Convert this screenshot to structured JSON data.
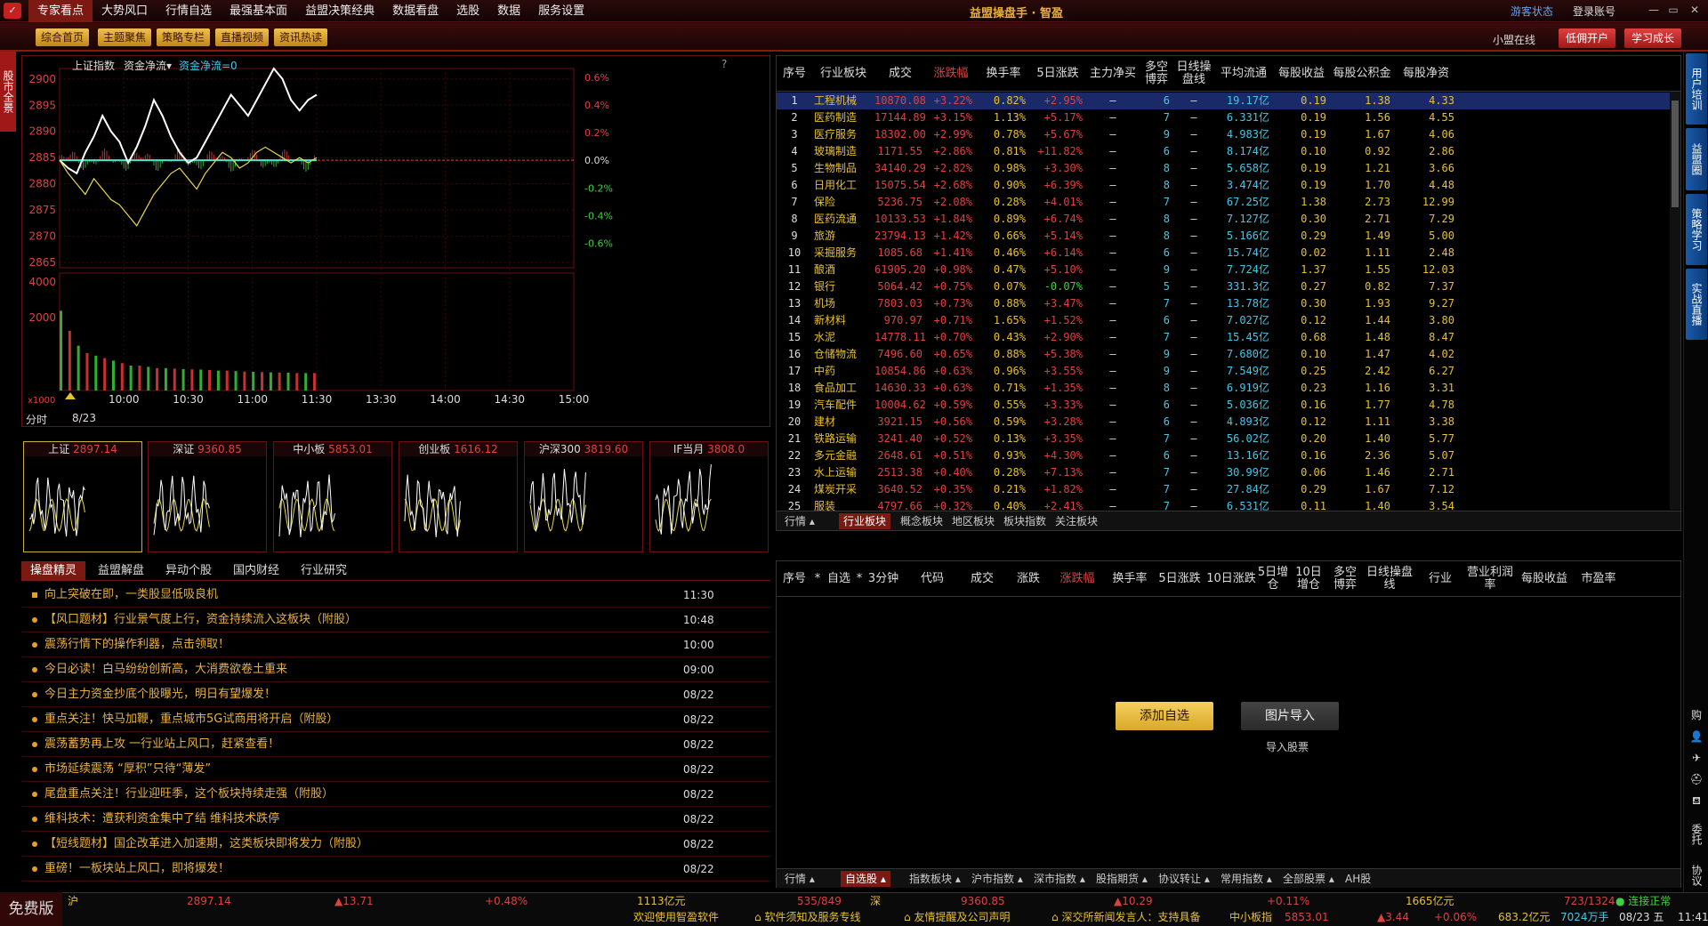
{
  "menubar": {
    "items": [
      "专家看点",
      "大势风口",
      "行情自选",
      "最强基本面",
      "益盟决策经典",
      "数据看盘",
      "选股",
      "数据",
      "服务设置"
    ],
    "active": 0,
    "app_title": "益盟操盘手 · 智盈",
    "guest": "游客状态",
    "account": "登录账号",
    "win_min": "—",
    "win_max": "▭",
    "win_close": "✕"
  },
  "toolbar": {
    "buttons": [
      "综合首页",
      "主题聚焦",
      "策略专栏",
      "直播视频",
      "资讯热读"
    ],
    "online": "小盟在线",
    "open_account": "低佣开户",
    "learn": "学习成长"
  },
  "leftstrip": {
    "tag": "股市全景"
  },
  "rightstrip": {
    "tabs": [
      "用户培训",
      "益盟圈",
      "策略学习",
      "实战直播"
    ],
    "icons": [
      "购",
      "👤",
      "✈",
      "⛑",
      "⛾",
      "委托",
      "协议"
    ]
  },
  "chart": {
    "index_name": "上证指数",
    "indicator": "资金净流▾",
    "indicator_value": "资金净流=0",
    "help": "?",
    "period": "分时",
    "date": "8/23",
    "unit": "x1000"
  },
  "chart_data": {
    "type": "line",
    "y_ticks": [
      2900,
      2895,
      2890,
      2885,
      2880,
      2875,
      2870,
      2865
    ],
    "pct_ticks": [
      "0.6%",
      "0.4%",
      "0.2%",
      "0.0%",
      "-0.2%",
      "-0.4%",
      "-0.6%"
    ],
    "vol_ticks": [
      4000,
      2000
    ],
    "x_ticks": [
      "10:00",
      "10:30",
      "11:00",
      "11:30",
      "13:30",
      "14:00",
      "14:30",
      "15:00"
    ],
    "ylim": [
      2864,
      2902
    ],
    "prev_close": 2884.5,
    "series": [
      {
        "values": [
          2884.5,
          2883,
          2882,
          2886,
          2889,
          2893,
          2890,
          2888,
          2884,
          2887,
          2891,
          2896,
          2893,
          2889,
          2886,
          2884,
          2885,
          2888,
          2891,
          2894,
          2897,
          2895,
          2893,
          2896,
          2899,
          2902,
          2900,
          2896,
          2894,
          2896,
          2897
        ]
      },
      {
        "values": [
          2884.5,
          2882,
          2880,
          2878,
          2881,
          2879,
          2877,
          2876,
          2874,
          2872,
          2875,
          2878,
          2880,
          2882,
          2883,
          2881,
          2879,
          2882,
          2884,
          2886,
          2885,
          2883,
          2884,
          2886,
          2887,
          2886,
          2885,
          2884,
          2885,
          2884,
          2885
        ]
      }
    ],
    "volume": [
      3200,
      2400,
      1800,
      1500,
      1400,
      1300,
      1200,
      1100,
      1000,
      1000,
      950,
      900,
      900,
      880,
      860,
      850,
      840,
      820,
      800,
      800,
      780,
      760,
      750,
      740,
      730,
      720,
      720,
      700,
      700,
      700
    ]
  },
  "minis": [
    {
      "name": "上证",
      "value": "2897.14"
    },
    {
      "name": "深证",
      "value": "9360.85"
    },
    {
      "name": "中小板",
      "value": "5853.01"
    },
    {
      "name": "创业板",
      "value": "1616.12"
    },
    {
      "name": "沪深300",
      "value": "3819.60"
    },
    {
      "name": "IF当月",
      "value": "3808.0"
    }
  ],
  "news": {
    "tabs": [
      "操盘精灵",
      "益盟解盘",
      "异动个股",
      "国内财经",
      "行业研究"
    ],
    "items": [
      {
        "title": "向上突破在即，一类股显低吸良机",
        "time": "11:30"
      },
      {
        "title": "【风口题材】行业景气度上行，资金持续流入这板块（附股）",
        "time": "10:48"
      },
      {
        "title": "震荡行情下的操作利器，点击领取！",
        "time": "10:00"
      },
      {
        "title": "今日必读！白马纷纷创新高，大消费欲卷土重来",
        "time": "09:00"
      },
      {
        "title": "今日主力资金抄底个股曝光，明日有望爆发！",
        "time": "08/22"
      },
      {
        "title": "重点关注！快马加鞭，重点城市5G试商用将开启（附股）",
        "time": "08/22"
      },
      {
        "title": "震荡蓄势再上攻 一行业站上风口，赶紧查看！",
        "time": "08/22"
      },
      {
        "title": "市场延续震荡 “厚积”只待“薄发”",
        "time": "08/22"
      },
      {
        "title": "尾盘重点关注！行业迎旺季，这个板块持续走强（附股）",
        "time": "08/22"
      },
      {
        "title": "维科技术：遭获利资金集中了结 维科技术跌停",
        "time": "08/22"
      },
      {
        "title": "【短线题材】国企改革进入加速期，这类板块即将发力（附股）",
        "time": "08/22"
      },
      {
        "title": "重磅！一板块站上风口，即将爆发！",
        "time": "08/22"
      }
    ]
  },
  "sectors": {
    "headers": [
      "序号",
      "行业板块",
      "成交",
      "涨跌幅",
      "换手率",
      "5日涨跌",
      "主力净买",
      "多空博弈",
      "日线操盘线",
      "平均流通",
      "每股收益",
      "每股公积金",
      "每股净资"
    ],
    "rows": [
      [
        "1",
        "工程机械",
        "10870.08",
        "+3.22%",
        "0.82%",
        "+2.95%",
        "—",
        "6",
        "—",
        "19.17亿",
        "0.19",
        "1.38",
        "4.33"
      ],
      [
        "2",
        "医药制造",
        "17144.89",
        "+3.15%",
        "1.13%",
        "+5.17%",
        "—",
        "7",
        "—",
        "6.331亿",
        "0.19",
        "1.56",
        "4.55"
      ],
      [
        "3",
        "医疗服务",
        "18302.00",
        "+2.99%",
        "0.78%",
        "+5.67%",
        "—",
        "9",
        "—",
        "4.983亿",
        "0.19",
        "1.67",
        "4.06"
      ],
      [
        "4",
        "玻璃制造",
        "1171.55",
        "+2.86%",
        "0.81%",
        "+11.82%",
        "—",
        "6",
        "—",
        "8.174亿",
        "0.10",
        "0.92",
        "2.86"
      ],
      [
        "5",
        "生物制品",
        "34140.29",
        "+2.82%",
        "0.98%",
        "+3.30%",
        "—",
        "8",
        "—",
        "5.658亿",
        "0.19",
        "1.21",
        "3.66"
      ],
      [
        "6",
        "日用化工",
        "15075.54",
        "+2.68%",
        "0.90%",
        "+6.39%",
        "—",
        "8",
        "—",
        "3.474亿",
        "0.19",
        "1.70",
        "4.48"
      ],
      [
        "7",
        "保险",
        "5236.75",
        "+2.08%",
        "0.28%",
        "+4.01%",
        "—",
        "7",
        "—",
        "67.25亿",
        "1.38",
        "2.73",
        "12.99"
      ],
      [
        "8",
        "医药流通",
        "10133.53",
        "+1.84%",
        "0.89%",
        "+6.74%",
        "—",
        "8",
        "—",
        "7.127亿",
        "0.30",
        "2.71",
        "7.29"
      ],
      [
        "9",
        "旅游",
        "23794.13",
        "+1.42%",
        "0.66%",
        "+5.14%",
        "—",
        "8",
        "—",
        "5.166亿",
        "0.29",
        "1.49",
        "5.00"
      ],
      [
        "10",
        "采掘服务",
        "1085.68",
        "+1.41%",
        "0.46%",
        "+6.14%",
        "—",
        "6",
        "—",
        "15.74亿",
        "0.02",
        "1.11",
        "2.48"
      ],
      [
        "11",
        "酿酒",
        "61905.20",
        "+0.98%",
        "0.47%",
        "+5.10%",
        "—",
        "9",
        "—",
        "7.724亿",
        "1.37",
        "1.55",
        "12.03"
      ],
      [
        "12",
        "银行",
        "5064.42",
        "+0.75%",
        "0.07%",
        "-0.07%",
        "—",
        "5",
        "—",
        "331.3亿",
        "0.27",
        "0.82",
        "7.37"
      ],
      [
        "13",
        "机场",
        "7803.03",
        "+0.73%",
        "0.88%",
        "+3.47%",
        "—",
        "7",
        "—",
        "13.78亿",
        "0.30",
        "1.93",
        "9.27"
      ],
      [
        "14",
        "新材料",
        "970.97",
        "+0.71%",
        "1.65%",
        "+1.52%",
        "—",
        "6",
        "—",
        "7.027亿",
        "0.12",
        "1.44",
        "3.80"
      ],
      [
        "15",
        "水泥",
        "14778.11",
        "+0.70%",
        "0.43%",
        "+2.90%",
        "—",
        "7",
        "—",
        "15.45亿",
        "0.68",
        "1.48",
        "8.47"
      ],
      [
        "16",
        "仓储物流",
        "7496.60",
        "+0.65%",
        "0.88%",
        "+5.38%",
        "—",
        "9",
        "—",
        "7.680亿",
        "0.10",
        "1.47",
        "4.02"
      ],
      [
        "17",
        "中药",
        "10854.86",
        "+0.63%",
        "0.96%",
        "+3.55%",
        "—",
        "9",
        "—",
        "7.549亿",
        "0.25",
        "2.42",
        "6.27"
      ],
      [
        "18",
        "食品加工",
        "14630.33",
        "+0.63%",
        "0.71%",
        "+1.35%",
        "—",
        "8",
        "—",
        "6.919亿",
        "0.23",
        "1.16",
        "3.31"
      ],
      [
        "19",
        "汽车配件",
        "10004.62",
        "+0.59%",
        "0.55%",
        "+3.33%",
        "—",
        "6",
        "—",
        "5.036亿",
        "0.16",
        "1.77",
        "4.78"
      ],
      [
        "20",
        "建材",
        "3921.15",
        "+0.56%",
        "0.59%",
        "+3.28%",
        "—",
        "6",
        "—",
        "4.893亿",
        "0.12",
        "1.11",
        "3.38"
      ],
      [
        "21",
        "铁路运输",
        "3241.40",
        "+0.52%",
        "0.13%",
        "+3.35%",
        "—",
        "7",
        "—",
        "56.02亿",
        "0.20",
        "1.40",
        "5.77"
      ],
      [
        "22",
        "多元金融",
        "2648.61",
        "+0.51%",
        "0.93%",
        "+4.30%",
        "—",
        "6",
        "—",
        "13.16亿",
        "0.16",
        "2.36",
        "5.07"
      ],
      [
        "23",
        "水上运输",
        "2513.38",
        "+0.40%",
        "0.28%",
        "+7.13%",
        "—",
        "7",
        "—",
        "30.99亿",
        "0.06",
        "1.46",
        "2.71"
      ],
      [
        "24",
        "煤炭开采",
        "3640.52",
        "+0.35%",
        "0.21%",
        "+1.82%",
        "—",
        "7",
        "—",
        "27.84亿",
        "0.29",
        "1.67",
        "7.12"
      ],
      [
        "25",
        "服装",
        "4797.66",
        "+0.32%",
        "0.40%",
        "+2.41%",
        "—",
        "7",
        "—",
        "6.531亿",
        "0.11",
        "1.40",
        "3.54"
      ],
      [
        "26",
        "农药",
        "11354.96",
        "+0.30%",
        "0.53%",
        "+3.36%",
        "—",
        "7",
        "—",
        "3.905亿",
        "0.20",
        "2.46",
        "5.90"
      ]
    ],
    "tabs": [
      "行情 ▴",
      "行业板块",
      "概念板块",
      "地区板块",
      "板块指数",
      "关注板块"
    ]
  },
  "watch": {
    "headers": [
      "序号",
      "*",
      "自选",
      "*",
      "3分钟",
      "代码",
      "成交",
      "涨跌",
      "涨跌幅",
      "换手率",
      "5日涨跌",
      "10日涨跌",
      "5日增仓",
      "10日增仓",
      "多空博弈",
      "日线操盘线",
      "行业",
      "营业利润率",
      "每股收益",
      "市盈率"
    ],
    "add_label": "添加自选",
    "img_label": "图片导入",
    "import_label": "导入股票",
    "tabs": [
      "行情 ▴",
      "自选股 ▴",
      "指数板块 ▴",
      "沪市指数 ▴",
      "深市指数 ▴",
      "股指期货 ▴",
      "协议转让 ▴",
      "常用指数 ▴",
      "全部股票 ▴",
      "AH股"
    ]
  },
  "status": {
    "free": "免费版",
    "sh_label": "沪",
    "sh_val": "2897.14",
    "sh_chg": "▲13.71",
    "sh_pct": "+0.48%",
    "sh_amt": "1113亿元",
    "sh_ud": "535/849",
    "sz_label": "深",
    "sz_val": "9360.85",
    "sz_chg": "▲10.29",
    "sz_pct": "+0.11%",
    "sz_amt": "1665亿元",
    "sz_ud": "723/1324",
    "conn": "连接正常",
    "welcome": "欢迎使用智盈软件",
    "notice1": "软件须知及服务专线",
    "notice2": "友情提醒及公司声明",
    "notice3": "深交所新闻发言人：支持具备",
    "zxb_label": "中小板指",
    "zxb_val": "5853.01",
    "zxb_chg": "▲3.44",
    "zxb_pct": "+0.06%",
    "zxb_amt": "683.2亿元",
    "hands": "7024万手",
    "date": "08/23 五",
    "time": "11:41"
  }
}
